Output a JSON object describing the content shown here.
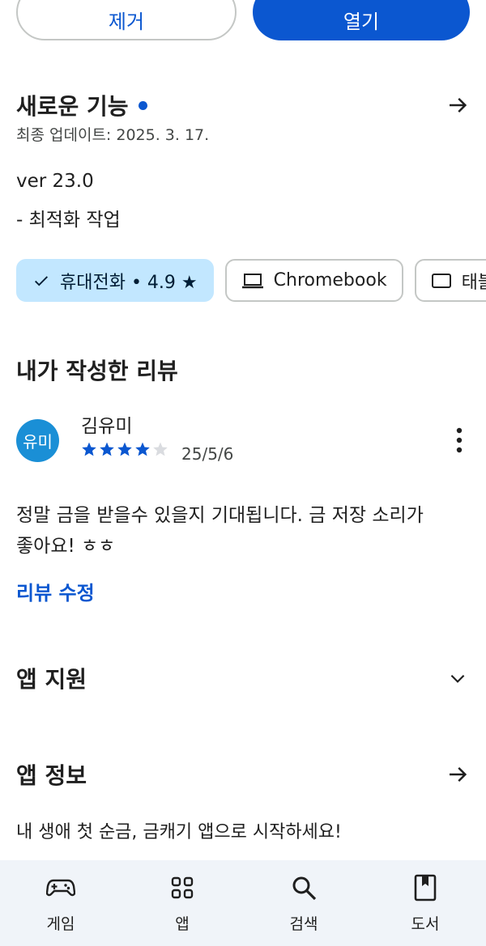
{
  "actions": {
    "uninstall_label": "제거",
    "open_label": "열기"
  },
  "whats_new": {
    "title": "새로운 기능",
    "updated": "최종 업데이트: 2025. 3. 17.",
    "version": "ver 23.0",
    "notes": "- 최적화 작업"
  },
  "device_chips": [
    {
      "label": "휴대전화 • 4.9 ★",
      "icon": "check-icon",
      "selected": true
    },
    {
      "label": "Chromebook",
      "icon": "laptop-icon",
      "selected": false
    },
    {
      "label": "태블릿",
      "icon": "tablet-icon",
      "selected": false
    }
  ],
  "my_review": {
    "title": "내가 작성한 리뷰",
    "avatar_text": "유미",
    "reviewer": "김유미",
    "rating": 4,
    "max_rating": 5,
    "date": "25/5/6",
    "text_line1": "정말 금을 받을수 있을지 기대됩니다. 금 저장 소리가",
    "text_line2": "좋아요! ㅎㅎ",
    "edit_label": "리뷰 수정"
  },
  "app_support": {
    "title": "앱 지원"
  },
  "app_info": {
    "title": "앱 정보",
    "description": "내 생애 첫 순금, 금캐기 앱으로 시작하세요!"
  },
  "bottom_nav": [
    {
      "label": "게임",
      "icon": "gamepad-icon"
    },
    {
      "label": "앱",
      "icon": "apps-grid-icon"
    },
    {
      "label": "검색",
      "icon": "search-icon"
    },
    {
      "label": "도서",
      "icon": "book-icon"
    }
  ],
  "colors": {
    "accent": "#0b57d0",
    "chip_selected": "#c2e7ff",
    "avatar": "#1a8fd6",
    "star_filled": "#0b57d0",
    "star_empty": "#dadce0"
  }
}
